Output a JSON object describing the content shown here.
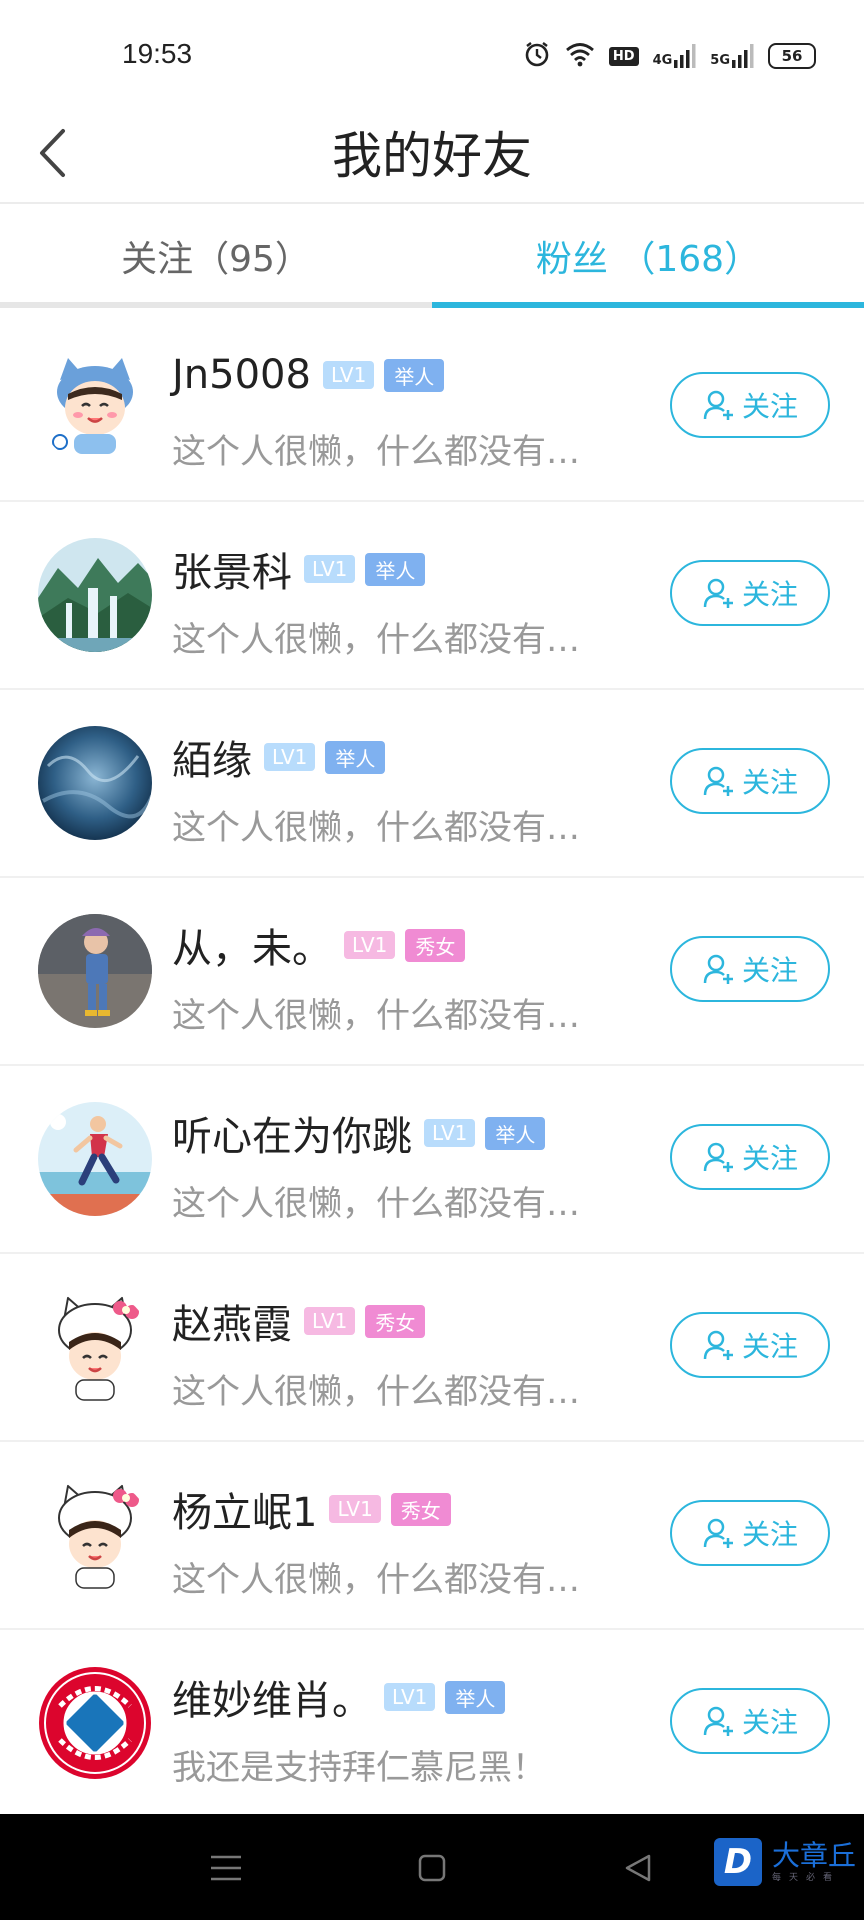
{
  "status_bar": {
    "time": "19:53",
    "battery": "56",
    "hd": "HD",
    "net1": "4G",
    "net2": "5G"
  },
  "header": {
    "title": "我的好友"
  },
  "tabs": [
    {
      "label": "关注（95）",
      "active": false
    },
    {
      "label": "粉丝 （168）",
      "active": true
    }
  ],
  "follow_label": "关注",
  "fans": [
    {
      "name": "Jn5008",
      "level": "LV1",
      "role": "举人",
      "gender": "male",
      "description": "这个人很懒，什么都没有…",
      "avatar": "cartoon-cat-hat"
    },
    {
      "name": "张景科",
      "level": "LV1",
      "role": "举人",
      "gender": "male",
      "description": "这个人很懒，什么都没有…",
      "avatar": "waterfall-landscape"
    },
    {
      "name": "絔缘",
      "level": "LV1",
      "role": "举人",
      "gender": "male",
      "description": "这个人很懒，什么都没有…",
      "avatar": "blue-texture"
    },
    {
      "name": "从，未。",
      "level": "LV1",
      "role": "秀女",
      "gender": "female",
      "description": "这个人很懒，什么都没有…",
      "avatar": "child-photo"
    },
    {
      "name": "听心在为你跳",
      "level": "LV1",
      "role": "举人",
      "gender": "male",
      "description": "这个人很懒，什么都没有…",
      "avatar": "runner"
    },
    {
      "name": "赵燕霞",
      "level": "LV1",
      "role": "秀女",
      "gender": "female",
      "description": "这个人很懒，什么都没有…",
      "avatar": "cartoon-kitty"
    },
    {
      "name": "杨立岷1",
      "level": "LV1",
      "role": "秀女",
      "gender": "female",
      "description": "这个人很懒，什么都没有…",
      "avatar": "cartoon-kitty"
    },
    {
      "name": "维妙维肖。",
      "level": "LV1",
      "role": "举人",
      "gender": "male",
      "description": "我还是支持拜仁慕尼黑！",
      "avatar": "fc-bayern-logo"
    }
  ],
  "watermark": {
    "brand": "大章丘",
    "slogan": "每天必看",
    "logo_letter": "D"
  },
  "colors": {
    "accent": "#2cb6dd",
    "male_tag": "#7fb1f0",
    "female_tag": "#f08bd3"
  }
}
